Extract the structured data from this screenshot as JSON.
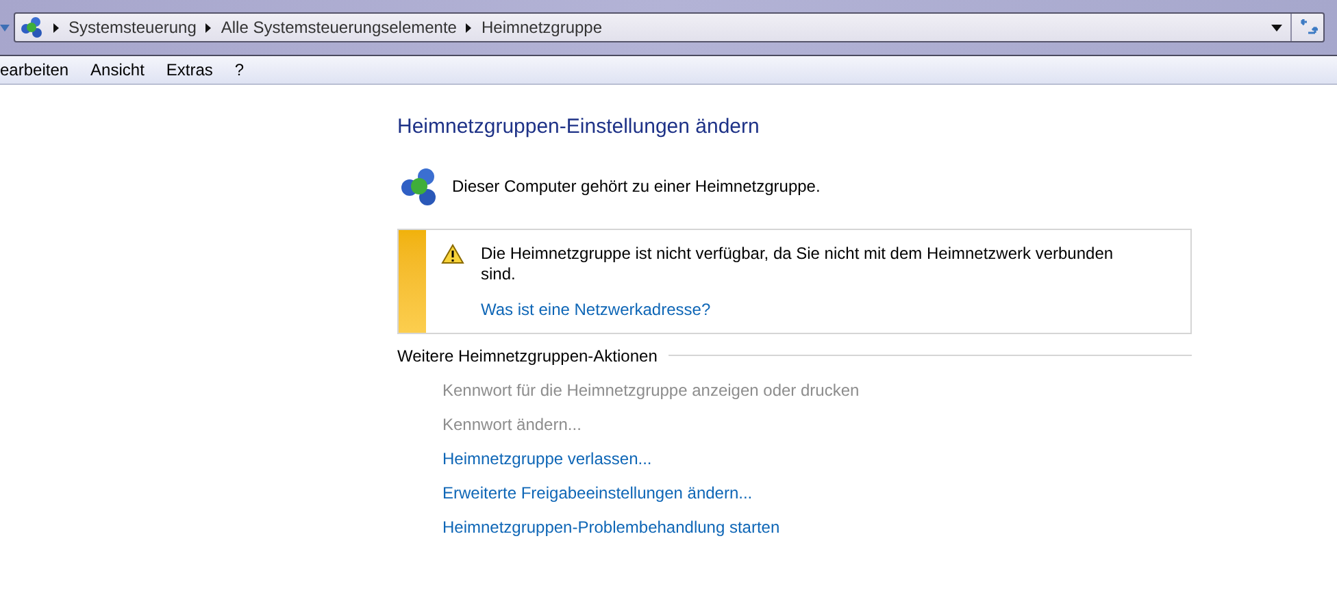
{
  "address_bar": {
    "segments": [
      "Systemsteuerung",
      "Alle Systemsteuerungselemente",
      "Heimnetzgruppe"
    ]
  },
  "menu_bar": [
    "earbeiten",
    "Ansicht",
    "Extras",
    "?"
  ],
  "heading": "Heimnetzgruppen-Einstellungen ändern",
  "status": "Dieser Computer gehört zu einer Heimnetzgruppe.",
  "warning": {
    "message": "Die Heimnetzgruppe ist nicht verfügbar, da Sie nicht mit dem Heimnetzwerk verbunden sind.",
    "link": "Was ist eine Netzwerkadresse?"
  },
  "actions": {
    "title": "Weitere Heimnetzgruppen-Aktionen",
    "items": [
      {
        "label": "Kennwort für die Heimnetzgruppe anzeigen oder drucken",
        "disabled": true
      },
      {
        "label": "Kennwort ändern...",
        "disabled": true
      },
      {
        "label": "Heimnetzgruppe verlassen...",
        "disabled": false
      },
      {
        "label": "Erweiterte Freigabeeinstellungen ändern...",
        "disabled": false
      },
      {
        "label": "Heimnetzgruppen-Problembehandlung starten",
        "disabled": false
      }
    ]
  }
}
